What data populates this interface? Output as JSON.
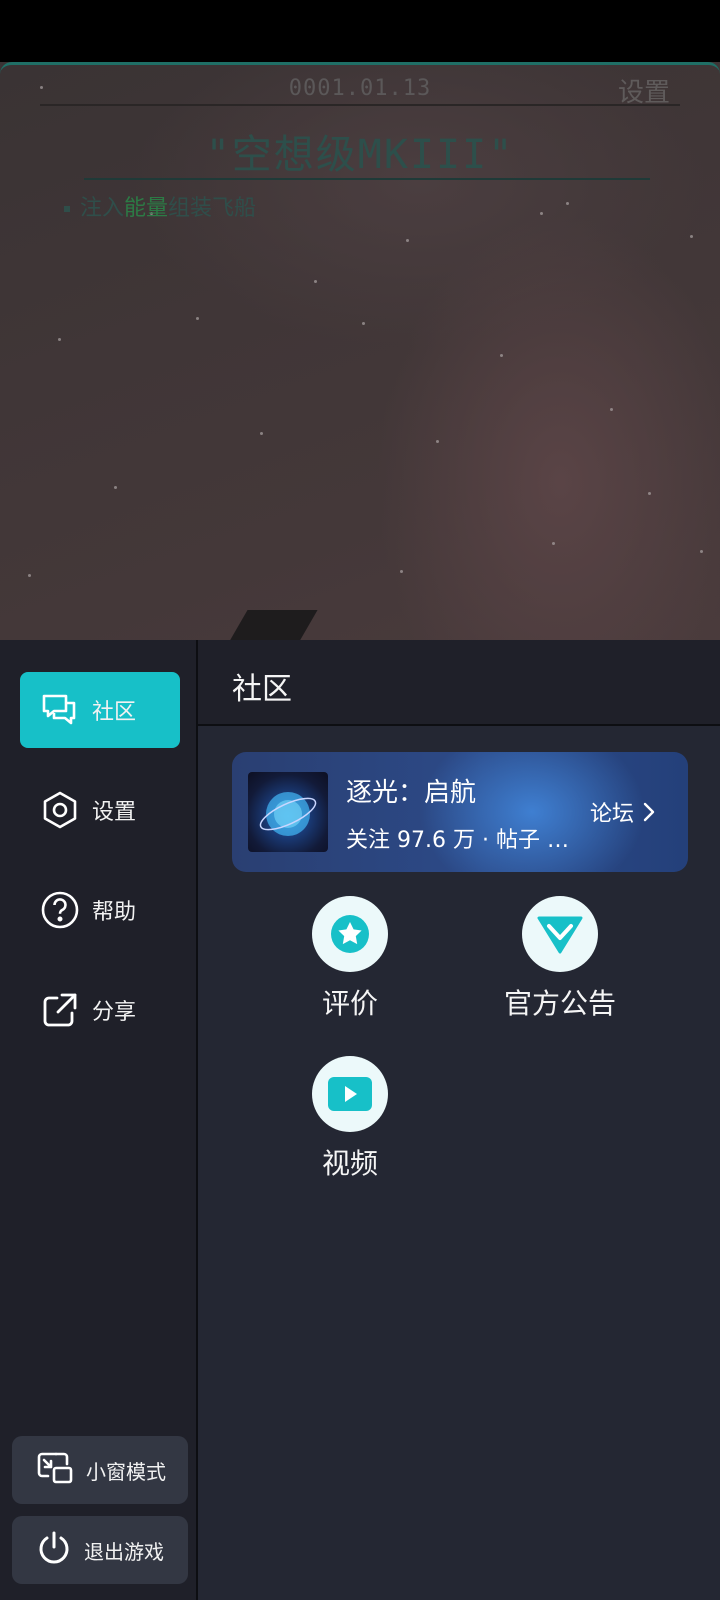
{
  "game": {
    "date": "0001.01.13",
    "settings_label": "设置",
    "title": "\"空想级MKIII\"",
    "hint_prefix": "注入",
    "hint_highlight": "能量",
    "hint_suffix": "组装飞船"
  },
  "sidebar": {
    "items": [
      {
        "label": "社区",
        "icon": "chat-bubbles-icon",
        "active": true
      },
      {
        "label": "设置",
        "icon": "hexagon-gear-icon",
        "active": false
      },
      {
        "label": "帮助",
        "icon": "question-circle-icon",
        "active": false
      },
      {
        "label": "分享",
        "icon": "share-external-icon",
        "active": false
      }
    ],
    "mini_window_label": "小窗模式",
    "exit_label": "退出游戏"
  },
  "panel": {
    "title": "社区",
    "forum": {
      "name": "逐光：启航",
      "stats": "关注 97.6 万 · 帖子 …",
      "link_label": "论坛"
    },
    "quick_links": [
      {
        "label": "评价",
        "icon": "star-badge-icon"
      },
      {
        "label": "官方公告",
        "icon": "diamond-chevron-icon"
      },
      {
        "label": "视频",
        "icon": "play-video-icon"
      }
    ]
  },
  "colors": {
    "accent": "#17c0c8",
    "sidebar_bg": "#1f2029",
    "panel_bg": "#242733",
    "button_bg": "#333743"
  }
}
